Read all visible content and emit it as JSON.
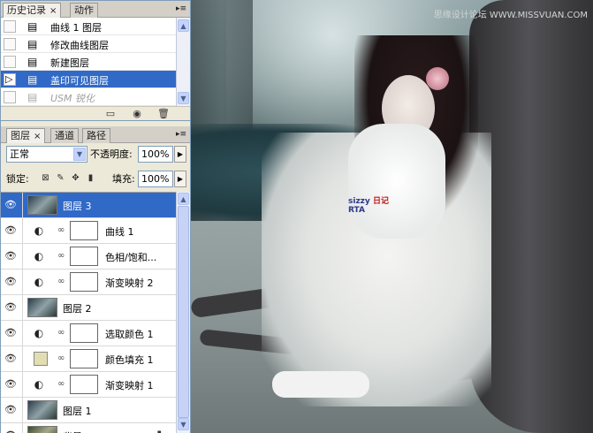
{
  "watermark": "思缘设计论坛 WWW.MISSVUAN.COM",
  "history": {
    "tabs": [
      {
        "label": "历史记录",
        "close": "×"
      },
      {
        "label": "动作"
      }
    ],
    "items": [
      {
        "label": "曲线 1 图层",
        "icon": "layer-step-icon"
      },
      {
        "label": "修改曲线图层",
        "icon": "layer-step-icon"
      },
      {
        "label": "新建图层",
        "icon": "layer-step-icon"
      },
      {
        "label": "盖印可见图层",
        "icon": "layer-step-icon",
        "selected": true
      },
      {
        "label": "USM 锐化",
        "icon": "layer-step-icon",
        "dimmed": true
      }
    ],
    "footer_buttons": [
      "new-document-from-state",
      "create-snapshot",
      "delete-state"
    ]
  },
  "layers": {
    "tabs": [
      {
        "label": "图层",
        "close": "×"
      },
      {
        "label": "通道"
      },
      {
        "label": "路径"
      }
    ],
    "blend_mode": "正常",
    "opacity_label": "不透明度:",
    "opacity_value": "100%",
    "lock_label": "锁定:",
    "fill_label": "填充:",
    "fill_value": "100%",
    "rows": [
      {
        "name": "图层 3",
        "kind": "pixel",
        "selected": true
      },
      {
        "name": "曲线 1",
        "kind": "adjustment"
      },
      {
        "name": "色相/饱和...",
        "kind": "adjustment"
      },
      {
        "name": "渐变映射 2",
        "kind": "adjustment"
      },
      {
        "name": "图层 2",
        "kind": "pixel"
      },
      {
        "name": "选取颜色 1",
        "kind": "adjustment"
      },
      {
        "name": "颜色填充 1",
        "kind": "fill",
        "color": "#e3ddb2"
      },
      {
        "name": "渐变映射 1",
        "kind": "adjustment"
      },
      {
        "name": "图层 1",
        "kind": "pixel"
      },
      {
        "name": "背景",
        "kind": "background"
      }
    ]
  },
  "photo": {
    "bear_text_blue": "RTA",
    "bear_text_red": "日记",
    "bear_text_small": "sizzy"
  },
  "colors": {
    "selection": "#3169c6",
    "panel_bg": "#ece9d8",
    "fill_swatch": "#e3ddb2"
  }
}
